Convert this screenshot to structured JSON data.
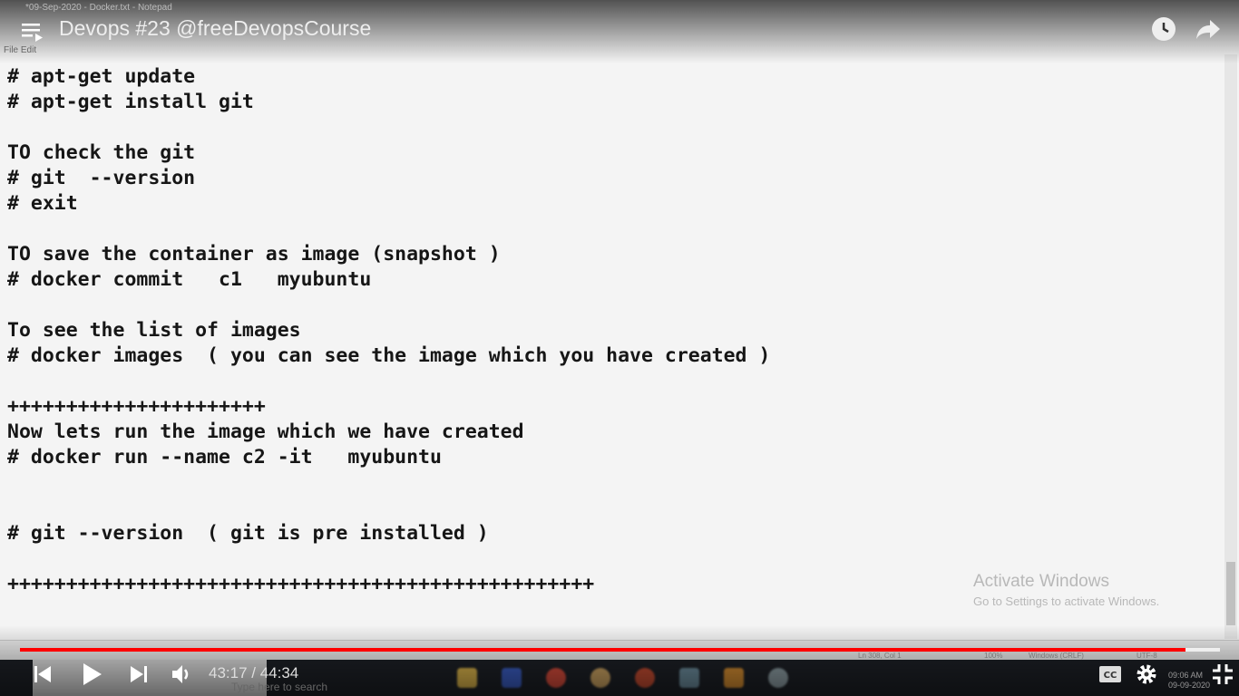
{
  "video": {
    "title": "Devops #23 @freeDevopsCourse",
    "current_time": "43:17",
    "duration": "44:34",
    "time_separator": " / ",
    "progress": 0.971,
    "accent": "#ff0000"
  },
  "notepad": {
    "window_title": "*09-Sep-2020 - Docker.txt - Notepad",
    "menu": "File  Edit",
    "lines": [
      "# apt-get update",
      "# apt-get install git",
      "",
      "TO check the git",
      "# git  --version",
      "# exit",
      "",
      "TO save the container as image (snapshot )",
      "# docker commit   c1   myubuntu",
      "",
      "To see the list of images",
      "# docker images  ( you can see the image which you have created )",
      "",
      "++++++++++++++++++++++",
      "Now lets run the image which we have created",
      "# docker run --name c2 -it   myubuntu",
      "",
      "",
      "# git --version  ( git is pre installed )",
      "",
      "++++++++++++++++++++++++++++++++++++++++++++++++++"
    ],
    "status": {
      "position": "Ln 308, Col 1",
      "zoom": "100%",
      "line_ending": "Windows (CRLF)",
      "encoding": "UTF-8"
    }
  },
  "watermark": {
    "line1": "Activate Windows",
    "line2": "Go to Settings to activate Windows."
  },
  "taskbar": {
    "search_placeholder": "Type here to search",
    "clock_time": "09:06 AM",
    "clock_date": "09-09-2020"
  }
}
